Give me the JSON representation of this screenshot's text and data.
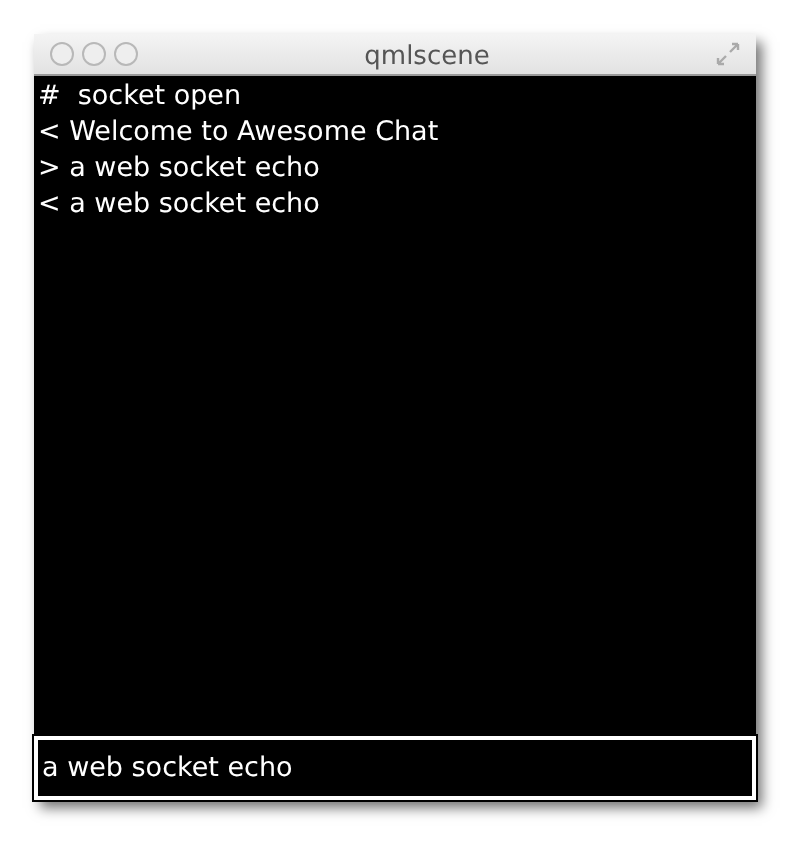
{
  "window": {
    "title": "qmlscene"
  },
  "messages": [
    "#  socket open",
    "< Welcome to Awesome Chat",
    "> a web socket echo",
    "< a web socket echo"
  ],
  "input": {
    "value": "a web socket echo"
  }
}
